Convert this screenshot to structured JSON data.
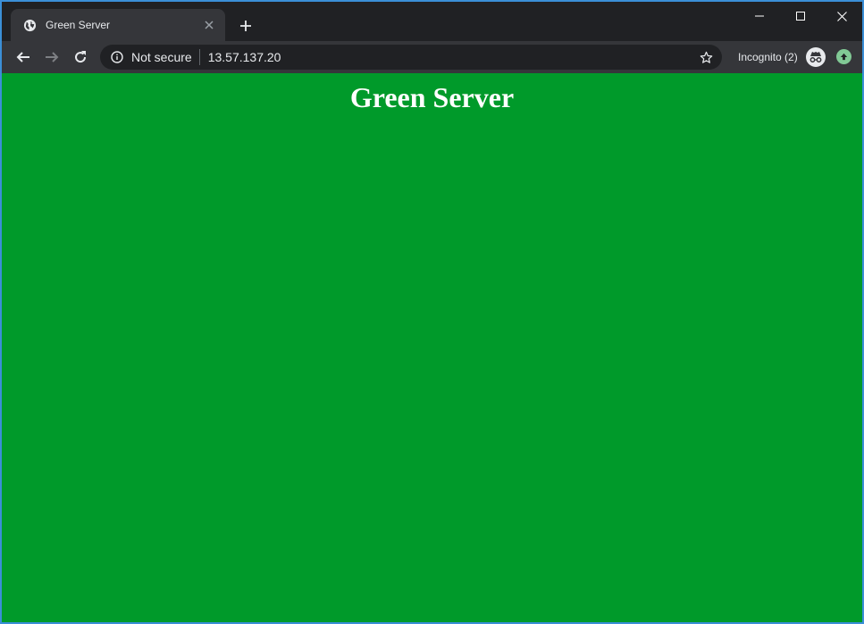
{
  "tab": {
    "title": "Green Server",
    "favicon": "globe-icon",
    "close_icon": "close-icon"
  },
  "new_tab_icon": "plus-icon",
  "window_controls": [
    "minimize-icon",
    "maximize-icon",
    "close-icon"
  ],
  "toolbar": {
    "back_icon": "back-arrow-icon",
    "forward_icon": "forward-arrow-icon",
    "reload_icon": "reload-icon",
    "omnibox": {
      "info_icon": "info-icon",
      "security_text": "Not secure",
      "url": "13.57.137.20",
      "bookmark_icon": "star-icon"
    },
    "incognito_label": "Incognito (2)",
    "incognito_icon": "incognito-icon",
    "update_icon": "update-arrow-icon"
  },
  "page": {
    "heading": "Green Server",
    "background_color": "#009a2a"
  },
  "colors": {
    "frame": "#202124",
    "toolbar": "#35363a",
    "text": "#e8eaed",
    "update_badge": "#81c995"
  }
}
